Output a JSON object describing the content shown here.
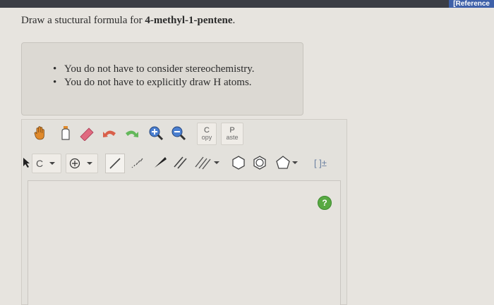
{
  "header": {
    "reference_label": "[Reference"
  },
  "question": {
    "prefix": "Draw a stuctural formula for ",
    "compound": "4-methyl-1-pentene",
    "suffix": "."
  },
  "hints": [
    "You do not have to consider stereochemistry.",
    "You do not have to explicitly draw H atoms."
  ],
  "toolbar": {
    "copy": {
      "top": "C",
      "bottom": "opy"
    },
    "paste": {
      "top": "P",
      "bottom": "aste"
    },
    "element_label": "C",
    "bracket_label": "[ ]±"
  },
  "canvas": {
    "help_label": "?"
  },
  "icons": [
    "hand-icon",
    "bottle-icon",
    "eraser-icon",
    "undo-icon",
    "redo-icon",
    "zoom-in-icon",
    "zoom-out-icon",
    "arrow-cursor-icon",
    "charge-plus-icon",
    "single-bond-icon",
    "stereo-hash-bond-icon",
    "stereo-wedge-bond-icon",
    "double-bond-icon",
    "triple-bond-icon",
    "hexagon-icon",
    "benzene-icon",
    "pentagon-icon",
    "chevron-down-icon",
    "help-icon"
  ],
  "colors": {
    "help": "#58a942",
    "reference": "#3e60a8",
    "eraser": "#e06a80",
    "undo": "#d95f4a",
    "redo": "#63b85a"
  }
}
